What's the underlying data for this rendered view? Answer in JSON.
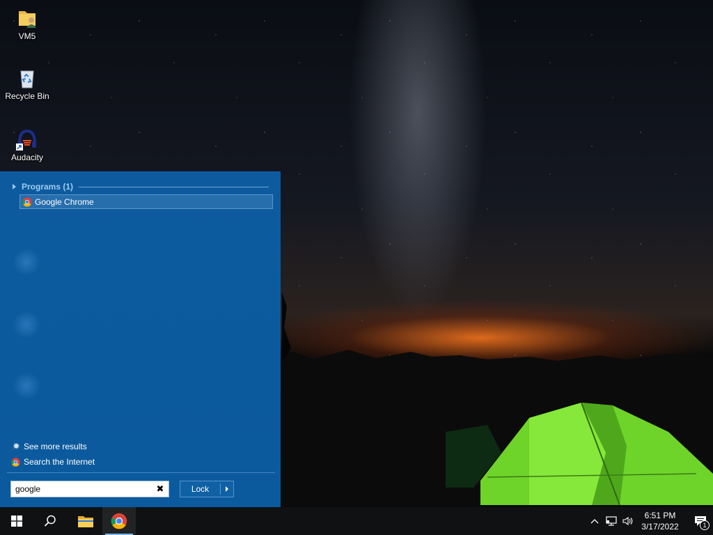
{
  "desktop": {
    "icons": [
      {
        "label": "VM5",
        "icon": "user-folder-icon"
      },
      {
        "label": "Recycle Bin",
        "icon": "recycle-bin-icon"
      },
      {
        "label": "Audacity",
        "icon": "audacity-icon"
      }
    ]
  },
  "start_menu": {
    "programs_header": "Programs (1)",
    "results": [
      {
        "label": "Google Chrome",
        "icon": "chrome-icon"
      }
    ],
    "see_more": "See more results",
    "search_internet": "Search the Internet",
    "search": {
      "value": "google",
      "clear_glyph": "✖"
    },
    "lock_button": "Lock"
  },
  "taskbar": {
    "pinned": [
      {
        "name": "start",
        "icon": "windows-logo-icon"
      },
      {
        "name": "search",
        "icon": "search-icon"
      },
      {
        "name": "file-explorer",
        "icon": "folder-icon"
      },
      {
        "name": "chrome",
        "icon": "chrome-icon",
        "active": true
      }
    ],
    "clock": {
      "time": "6:51 PM",
      "date": "3/17/2022"
    },
    "notifications": {
      "count": "1"
    }
  },
  "colors": {
    "start_menu_bg": "#0b5a9d",
    "header_text": "#9fcbf2",
    "taskbar_bg": "#101113",
    "active_indicator": "#76b9ed",
    "tent_green": "#7ee12a"
  }
}
